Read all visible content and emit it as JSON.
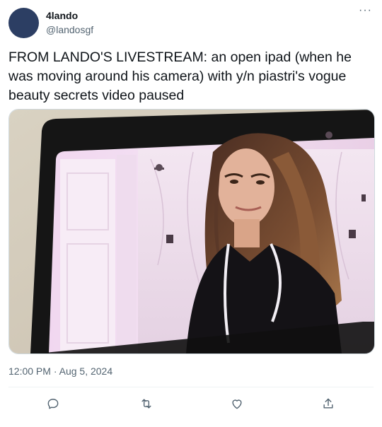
{
  "author": {
    "display_name": "4lando",
    "handle": "@landosgf",
    "avatar_color": "#2c3e63"
  },
  "more_label": "···",
  "tweet": {
    "text": "FROM LANDO'S LIVESTREAM: an open ipad (when he was moving around his camera) with y/n piastri's vogue beauty secrets video paused",
    "time": "12:00 PM",
    "separator": " · ",
    "date": "Aug 5, 2024"
  },
  "media": {
    "icon": "photo-icon"
  },
  "actions": [
    {
      "name": "reply",
      "icon": "reply-icon"
    },
    {
      "name": "retweet",
      "icon": "retweet-icon"
    },
    {
      "name": "like",
      "icon": "heart-icon"
    },
    {
      "name": "share",
      "icon": "share-icon"
    }
  ],
  "colors": {
    "text": "#0f1419",
    "secondary": "#536471",
    "divider": "#eff3f4",
    "icon": "#536471"
  }
}
